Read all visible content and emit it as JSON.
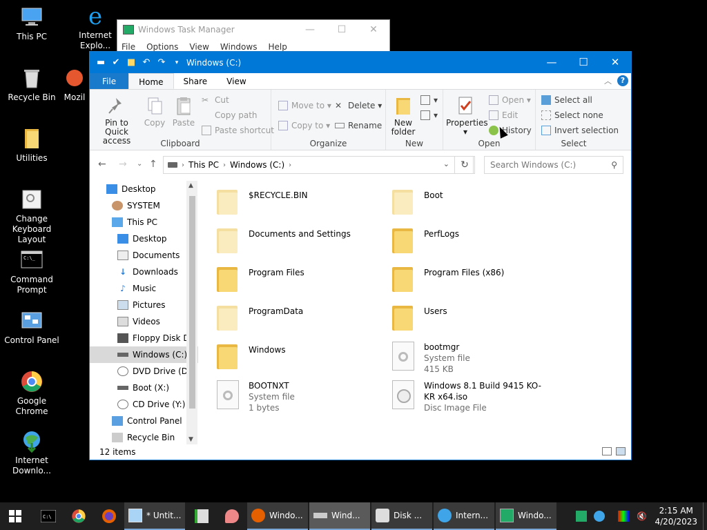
{
  "desktop": {
    "icons": [
      {
        "label": "This PC"
      },
      {
        "label": "Internet Explo..."
      },
      {
        "label": "Recycle Bin"
      },
      {
        "label": "Mozil"
      },
      {
        "label": "Utilities"
      },
      {
        "label": "Change Keyboard Layout"
      },
      {
        "label": "Command Prompt"
      },
      {
        "label": "Control Panel"
      },
      {
        "label": "Google Chrome"
      },
      {
        "label": "Internet Downlo..."
      }
    ]
  },
  "taskmgr": {
    "title": "Windows Task Manager",
    "menu": [
      "File",
      "Options",
      "View",
      "Windows",
      "Help"
    ]
  },
  "explorer": {
    "title": "Windows (C:)",
    "tabs": {
      "file": "File",
      "home": "Home",
      "share": "Share",
      "view": "View"
    },
    "ribbon": {
      "clipboard": {
        "group": "Clipboard",
        "pin": "Pin to Quick access",
        "copy": "Copy",
        "paste": "Paste",
        "cut": "Cut",
        "copy_path": "Copy path",
        "paste_shortcut": "Paste shortcut"
      },
      "organize": {
        "group": "Organize",
        "move_to": "Move to",
        "copy_to": "Copy to",
        "delete": "Delete",
        "rename": "Rename"
      },
      "new": {
        "group": "New",
        "new_folder": "New folder"
      },
      "open": {
        "group": "Open",
        "properties": "Properties",
        "open": "Open",
        "edit": "Edit",
        "history": "History"
      },
      "select": {
        "group": "Select",
        "select_all": "Select all",
        "select_none": "Select none",
        "invert": "Invert selection"
      }
    },
    "address": {
      "crumbs": [
        "This PC",
        "Windows (C:)"
      ],
      "search_placeholder": "Search Windows (C:)"
    },
    "nav": [
      {
        "label": "Desktop"
      },
      {
        "label": "SYSTEM"
      },
      {
        "label": "This PC"
      },
      {
        "label": "Desktop"
      },
      {
        "label": "Documents"
      },
      {
        "label": "Downloads"
      },
      {
        "label": "Music"
      },
      {
        "label": "Pictures"
      },
      {
        "label": "Videos"
      },
      {
        "label": "Floppy Disk Dri"
      },
      {
        "label": "Windows (C:)"
      },
      {
        "label": "DVD Drive (D:)"
      },
      {
        "label": "Boot (X:)"
      },
      {
        "label": "CD Drive (Y:) H"
      },
      {
        "label": "Control Panel"
      },
      {
        "label": "Recycle Bin"
      }
    ],
    "items": [
      {
        "name": "$RECYCLE.BIN"
      },
      {
        "name": "Boot"
      },
      {
        "name": "Documents and Settings"
      },
      {
        "name": "PerfLogs"
      },
      {
        "name": "Program Files"
      },
      {
        "name": "Program Files (x86)"
      },
      {
        "name": "ProgramData"
      },
      {
        "name": "Users"
      },
      {
        "name": "Windows"
      },
      {
        "name": "bootmgr",
        "type": "System file",
        "size": "415 KB"
      },
      {
        "name": "BOOTNXT",
        "type": "System file",
        "size": "1 bytes"
      },
      {
        "name": "Windows 8.1 Build 9415 KO-KR x64.iso",
        "type": "Disc Image File"
      }
    ],
    "status": "12 items"
  },
  "taskbar": {
    "buttons": [
      {
        "label": "* Untit..."
      },
      {
        "label": "Windo..."
      },
      {
        "label": "Wind..."
      },
      {
        "label": "Disk ..."
      },
      {
        "label": "Intern..."
      },
      {
        "label": "Windo..."
      }
    ],
    "time": "2:15 AM",
    "date": "4/20/2023"
  },
  "colors": {
    "accent": "#0078d7",
    "folder": "#f8d775",
    "taskbar": "#1f1f1f"
  }
}
